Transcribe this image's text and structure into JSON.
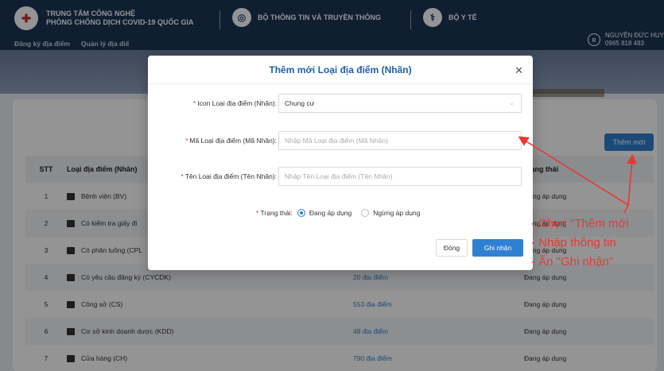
{
  "header": {
    "brand_line1": "TRUNG TÂM CÔNG NGHỆ",
    "brand_line2": "PHÒNG CHỐNG DỊCH COVID-19 QUỐC GIA",
    "org1": "BỘ THÔNG TIN VÀ TRUYỀN THÔNG",
    "org2": "BỘ Y TẾ",
    "nav": [
      "Đăng ký địa điểm",
      "Quản lý địa điể"
    ],
    "user_name": "NGUYỄN ĐỨC HUY",
    "user_phone": "0965 818 483"
  },
  "page": {
    "add_button": "Thêm mới",
    "columns": {
      "stt": "STT",
      "name": "Loại địa điểm (Nhãn)",
      "status": "Trạng thái"
    },
    "rows": [
      {
        "stt": "1",
        "name": "Bệnh viện (BV)",
        "count": "",
        "status": "Đang áp dụng"
      },
      {
        "stt": "2",
        "name": "Có kiểm tra giấy đi",
        "count": "",
        "status": "Đang áp dụng"
      },
      {
        "stt": "3",
        "name": "Có phân luồng (CPL",
        "count": "",
        "status": "Đang áp dụng"
      },
      {
        "stt": "4",
        "name": "Có yêu cầu đăng ký (CYCDK)",
        "count": "20 địa điểm",
        "status": "Đang áp dụng"
      },
      {
        "stt": "5",
        "name": "Công sở (CS)",
        "count": "553 địa điểm",
        "status": "Đang áp dụng"
      },
      {
        "stt": "6",
        "name": "Cơ sở kinh doanh dược (KDD)",
        "count": "48 địa điểm",
        "status": "Đang áp dụng"
      },
      {
        "stt": "7",
        "name": "Cửa hàng (CH)",
        "count": "790 địa điểm",
        "status": "Đang áp dụng"
      }
    ]
  },
  "modal": {
    "title": "Thêm mới Loại địa điểm (Nhãn)",
    "icon_label": "Icon Loại địa điểm (Nhãn):",
    "icon_value": "Chung cư",
    "code_label": "Mã Loại địa điểm (Mã Nhãn):",
    "code_placeholder": "Nhập Mã Loại địa điểm (Mã Nhãn)",
    "name_label": "Tên Loại địa điểm (Tên Nhãn):",
    "name_placeholder": "Nhập Tên Loại địa điểm (Tên Nhãn)",
    "status_label": "Trạng thái:",
    "status_on": "Đang áp dụng",
    "status_off": "Ngừng áp dụng",
    "close_button": "Đóng",
    "save_button": "Ghi nhận"
  },
  "annotation": {
    "line1": "- Chọn \"Thêm mới",
    "line2": "- Nhập thông tin",
    "line3": "- Ấn \"Ghi nhận\""
  },
  "colors": {
    "header": "#1d3557",
    "primary": "#2f80d1",
    "annotation": "#e53935"
  }
}
